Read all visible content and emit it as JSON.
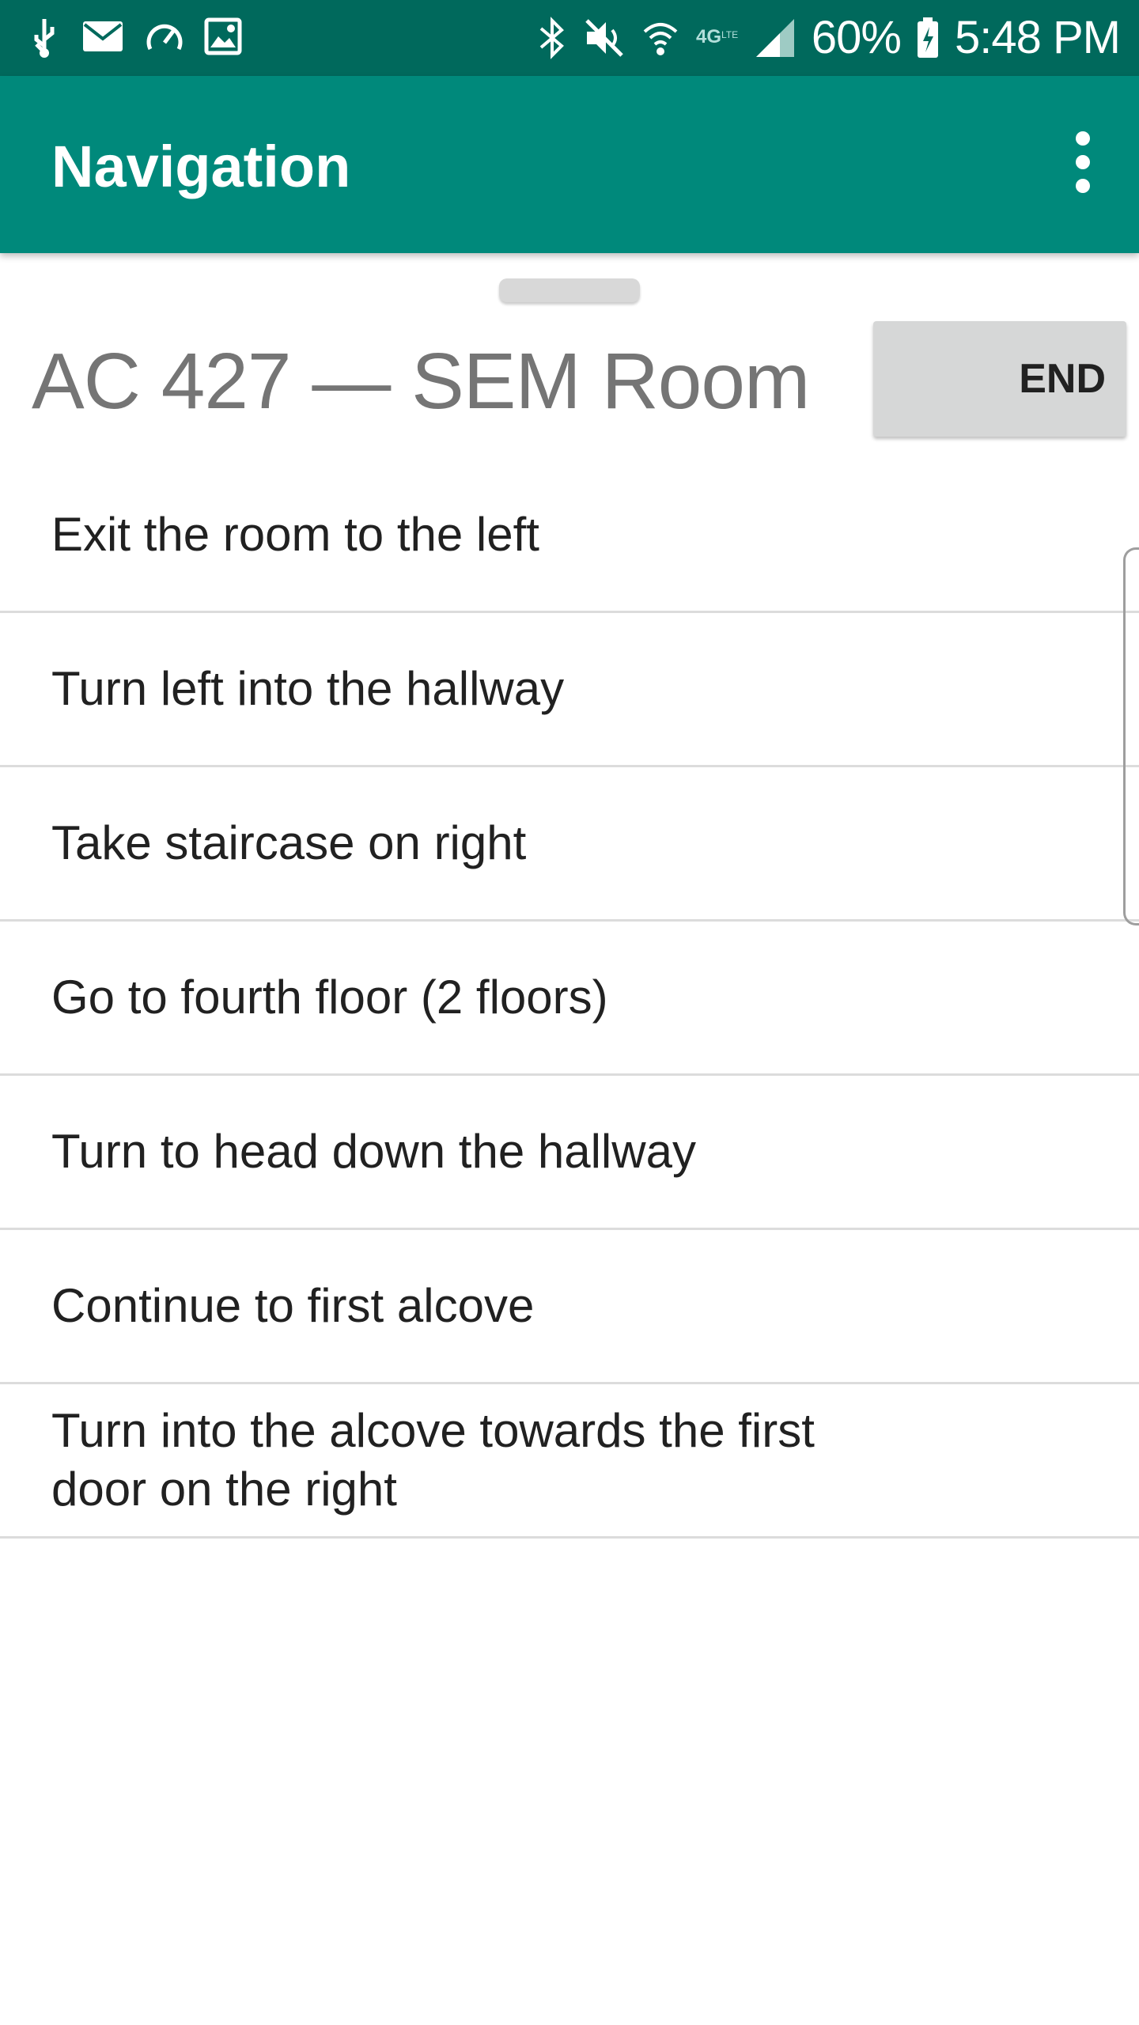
{
  "status_bar": {
    "battery": "60%",
    "time": "5:48 PM",
    "icons_left": [
      "usb-icon",
      "mail-icon",
      "speed-icon",
      "image-icon"
    ],
    "icons_right": [
      "bluetooth-icon",
      "mute-icon",
      "wifi-icon",
      "lte-icon",
      "signal-icon",
      "battery-icon"
    ]
  },
  "app_bar": {
    "title": "Navigation",
    "menu_icon": "more-vert-icon",
    "background": "#00897b"
  },
  "header": {
    "destination": "AC 427 — SEM Room",
    "end_label": "END"
  },
  "steps": [
    {
      "text": "Exit the room to the left"
    },
    {
      "text": "Turn left into the hallway"
    },
    {
      "text": "Take staircase on right"
    },
    {
      "text": "Go to fourth floor (2 floors)"
    },
    {
      "text": "Turn to head down the hallway"
    },
    {
      "text": "Continue to first alcove"
    },
    {
      "text": "Turn into the alcove towards the first door on the right"
    }
  ]
}
